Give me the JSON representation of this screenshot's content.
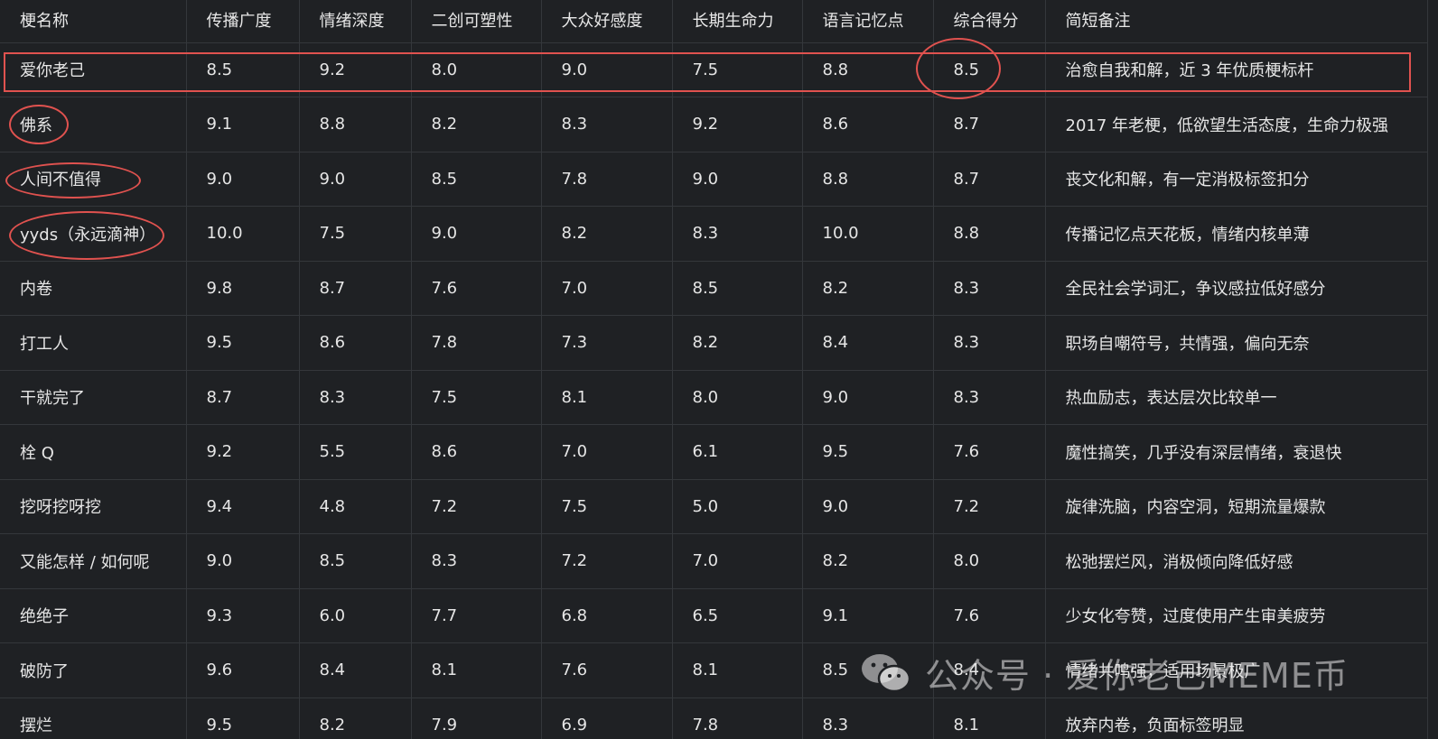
{
  "headers": [
    "梗名称",
    "传播广度",
    "情绪深度",
    "二创可塑性",
    "大众好感度",
    "长期生命力",
    "语言记忆点",
    "综合得分",
    "简短备注"
  ],
  "rows": [
    [
      "爱你老己",
      "8.5",
      "9.2",
      "8.0",
      "9.0",
      "7.5",
      "8.8",
      "8.5",
      "治愈自我和解，近 3 年优质梗标杆"
    ],
    [
      "佛系",
      "9.1",
      "8.8",
      "8.2",
      "8.3",
      "9.2",
      "8.6",
      "8.7",
      "2017 年老梗，低欲望生活态度，生命力极强"
    ],
    [
      "人间不值得",
      "9.0",
      "9.0",
      "8.5",
      "7.8",
      "9.0",
      "8.8",
      "8.7",
      "丧文化和解，有一定消极标签扣分"
    ],
    [
      "yyds（永远滴神）",
      "10.0",
      "7.5",
      "9.0",
      "8.2",
      "8.3",
      "10.0",
      "8.8",
      "传播记忆点天花板，情绪内核单薄"
    ],
    [
      "内卷",
      "9.8",
      "8.7",
      "7.6",
      "7.0",
      "8.5",
      "8.2",
      "8.3",
      "全民社会学词汇，争议感拉低好感分"
    ],
    [
      "打工人",
      "9.5",
      "8.6",
      "7.8",
      "7.3",
      "8.2",
      "8.4",
      "8.3",
      "职场自嘲符号，共情强，偏向无奈"
    ],
    [
      "干就完了",
      "8.7",
      "8.3",
      "7.5",
      "8.1",
      "8.0",
      "9.0",
      "8.3",
      "热血励志，表达层次比较单一"
    ],
    [
      "栓 Q",
      "9.2",
      "5.5",
      "8.6",
      "7.0",
      "6.1",
      "9.5",
      "7.6",
      "魔性搞笑，几乎没有深层情绪，衰退快"
    ],
    [
      "挖呀挖呀挖",
      "9.4",
      "4.8",
      "7.2",
      "7.5",
      "5.0",
      "9.0",
      "7.2",
      "旋律洗脑，内容空洞，短期流量爆款"
    ],
    [
      "又能怎样 / 如何呢",
      "9.0",
      "8.5",
      "8.3",
      "7.2",
      "7.0",
      "8.2",
      "8.0",
      "松弛摆烂风，消极倾向降低好感"
    ],
    [
      "绝绝子",
      "9.3",
      "6.0",
      "7.7",
      "6.8",
      "6.5",
      "9.1",
      "7.6",
      "少女化夸赞，过度使用产生审美疲劳"
    ],
    [
      "破防了",
      "9.6",
      "8.4",
      "8.1",
      "7.6",
      "8.1",
      "8.5",
      "8.4",
      "情绪共鸣强，适用场景极广"
    ],
    [
      "摆烂",
      "9.5",
      "8.2",
      "7.9",
      "6.9",
      "7.8",
      "8.3",
      "8.1",
      "放弃内卷，负面标签明显"
    ]
  ],
  "watermark": "公众号 · 爱你老己MEME币",
  "annotation_color": "#e0524f"
}
